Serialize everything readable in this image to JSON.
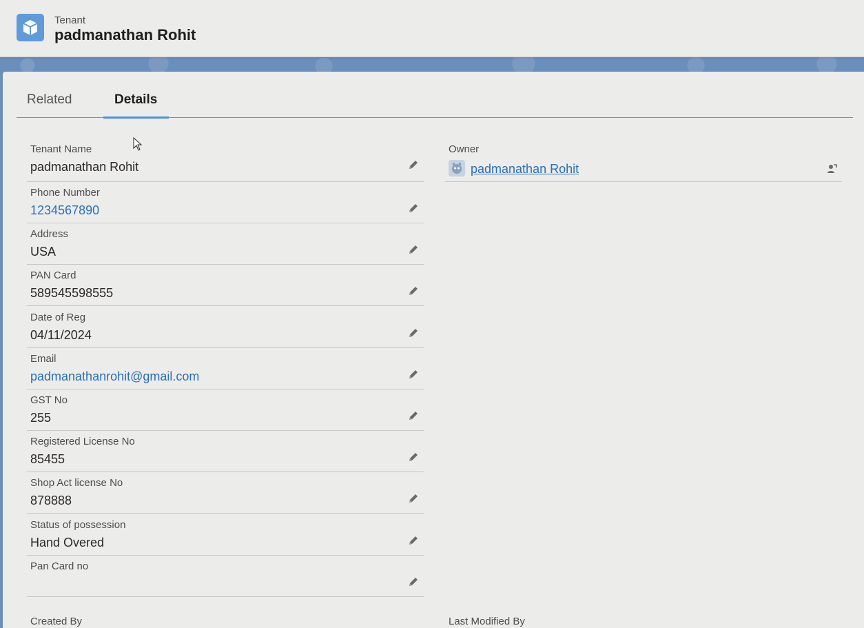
{
  "header": {
    "object_type": "Tenant",
    "record_name": "padmanathan Rohit",
    "icon": "cube-icon"
  },
  "tabs": [
    {
      "label": "Related",
      "active": false
    },
    {
      "label": "Details",
      "active": true
    }
  ],
  "fields": [
    {
      "label": "Tenant Name",
      "value": "padmanathan Rohit",
      "link": false
    },
    {
      "label": "Phone Number",
      "value": "1234567890",
      "link": true
    },
    {
      "label": "Address",
      "value": "USA",
      "link": false
    },
    {
      "label": "PAN Card",
      "value": "589545598555",
      "link": false
    },
    {
      "label": "Date of Reg",
      "value": "04/11/2024",
      "link": false
    },
    {
      "label": "Email",
      "value": "padmanathanrohit@gmail.com",
      "link": true
    },
    {
      "label": "GST No",
      "value": "255",
      "link": false
    },
    {
      "label": "Registered License No",
      "value": "85455",
      "link": false
    },
    {
      "label": "Shop Act license No",
      "value": "878888",
      "link": false
    },
    {
      "label": "Status of possession",
      "value": "Hand Overed",
      "link": false
    },
    {
      "label": "Pan Card no",
      "value": "",
      "link": false
    }
  ],
  "owner": {
    "label": "Owner",
    "name": "padmanathan Rohit",
    "avatar_icon": "user-avatar-icon",
    "action_icon": "change-owner-icon"
  },
  "footer": {
    "created_by_label": "Created By",
    "last_modified_by_label": "Last Modified By"
  },
  "colors": {
    "accent": "#4a90d9",
    "link": "#2a6fb5",
    "icon_bg": "#5f9ad9",
    "background": "#6b8fbd"
  }
}
